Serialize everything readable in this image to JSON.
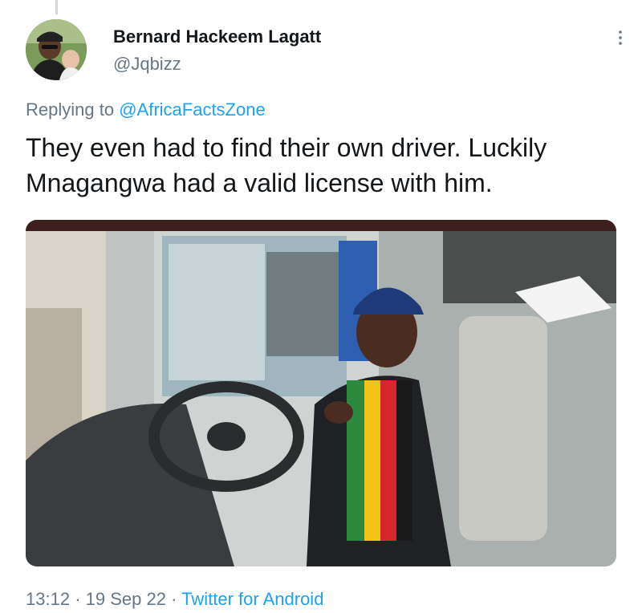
{
  "tweet": {
    "author": {
      "display_name": "Bernard Hackeem Lagatt",
      "handle": "@Jqbizz"
    },
    "replying_prefix": "Replying to",
    "replying_to": "@AfricaFactsZone",
    "text": "They even had to find their own driver. Luckily Mnagangwa had a valid license with him.",
    "time": "13:12",
    "separator": "·",
    "date": "19 Sep 22",
    "source": "Twitter for Android"
  },
  "icons": {
    "more": "more-vertical-icon"
  },
  "colors": {
    "link": "#1da1f2",
    "secondary_text": "#657786",
    "primary_text": "#14171a"
  }
}
